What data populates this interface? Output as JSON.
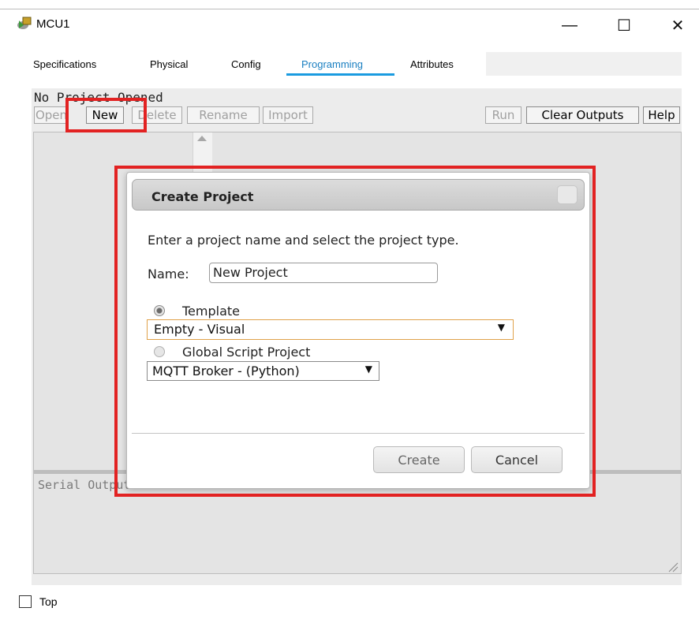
{
  "window": {
    "title": "MCU1",
    "app_icon": "mcu-device-icon",
    "minimize_glyph": "—",
    "maximize_glyph": "☐",
    "close_glyph": "✕"
  },
  "tabs": [
    {
      "label": "Specifications"
    },
    {
      "label": "Physical"
    },
    {
      "label": "Config"
    },
    {
      "label": "Programming",
      "active": true
    },
    {
      "label": "Attributes"
    }
  ],
  "programming": {
    "status": "No Project Opened",
    "toolbar": {
      "open": "Open",
      "new": "New",
      "delete": "Delete",
      "rename": "Rename",
      "import": "Import",
      "run": "Run",
      "clear_outputs": "Clear Outputs",
      "help": "Help"
    },
    "serial_output_label": "Serial Output"
  },
  "dialog": {
    "title": "Create Project",
    "instruction": "Enter a project name and select the project type.",
    "name_label": "Name:",
    "name_value": "New Project",
    "template_label": "Template",
    "template_selected": true,
    "template_value": "Empty - Visual",
    "global_label": "Global Script Project",
    "global_selected": false,
    "global_value": "MQTT Broker - (Python)",
    "create_label": "Create",
    "cancel_label": "Cancel"
  },
  "footer": {
    "top_label": "Top",
    "top_checked": false
  },
  "colors": {
    "tab_active": "#1a7fc1",
    "tab_underline": "#1a9be0",
    "highlight": "#e22222",
    "select_focus": "#e0a24a"
  }
}
